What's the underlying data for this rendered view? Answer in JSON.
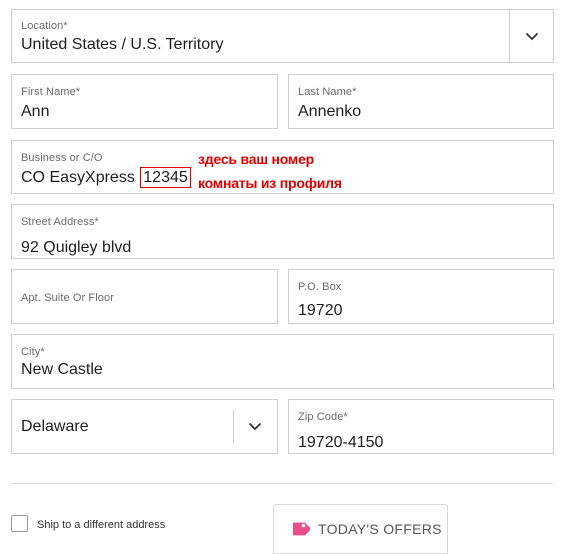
{
  "form": {
    "location": {
      "label": "Location*",
      "value": "United States / U.S. Territory"
    },
    "first_name": {
      "label": "First Name*",
      "value": "Ann"
    },
    "last_name": {
      "label": "Last Name*",
      "value": "Annenko"
    },
    "business": {
      "label": "Business or C/O",
      "value": "CO EasyXpress",
      "highlight": "12345"
    },
    "street": {
      "label": "Street Address*",
      "value": "92 Quigley blvd"
    },
    "apt": {
      "label": "Apt. Suite Or Floor",
      "value": ""
    },
    "po_box": {
      "label": "P.O. Box",
      "value": "19720"
    },
    "city": {
      "label": "City*",
      "value": "New Castle"
    },
    "state": {
      "value": "Delaware"
    },
    "zip": {
      "label": "Zip Code*",
      "value": "19720-4150"
    }
  },
  "annotation": {
    "line1": "здесь ваш номер",
    "line2": "комнаты из профиля",
    "color": "#e10000"
  },
  "ship_different": {
    "label": "Ship to a different address",
    "checked": false
  },
  "offers_button": {
    "label": "TODAY'S OFFERS",
    "icon": "tag-icon",
    "icon_color": "#e84e8a"
  }
}
